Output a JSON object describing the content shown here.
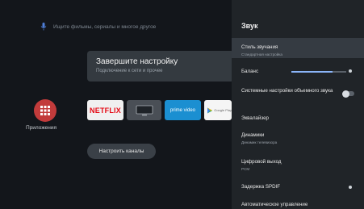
{
  "search": {
    "placeholder": "Ищите фильмы, сериалы и многое другое"
  },
  "setup_card": {
    "title": "Завершите настройку",
    "subtitle": "Подключение к сети и прочее"
  },
  "apps": {
    "label": "Приложения"
  },
  "tiles": {
    "netflix": "NETFLIX",
    "prime": "prime video",
    "play": "Google Play"
  },
  "channels_button": "Настроить каналы",
  "panel": {
    "title": "Звук",
    "sound_style": {
      "label": "Стиль звучания",
      "value": "Стандартная настройка"
    },
    "balance": {
      "label": "Баланс",
      "level": 0.75
    },
    "system_sounds": {
      "label": "Системные настройки объемного звука",
      "enabled": false
    },
    "equalizer": {
      "label": "Эквалайзер"
    },
    "speakers": {
      "label": "Динамики",
      "value": "Динамик телевизора"
    },
    "digital_out": {
      "label": "Цифровой выход",
      "value": "PCM"
    },
    "spdif_delay": {
      "label": "Задержка SPDIF"
    },
    "auto_volume": {
      "label": "Автоматическое управление"
    }
  }
}
